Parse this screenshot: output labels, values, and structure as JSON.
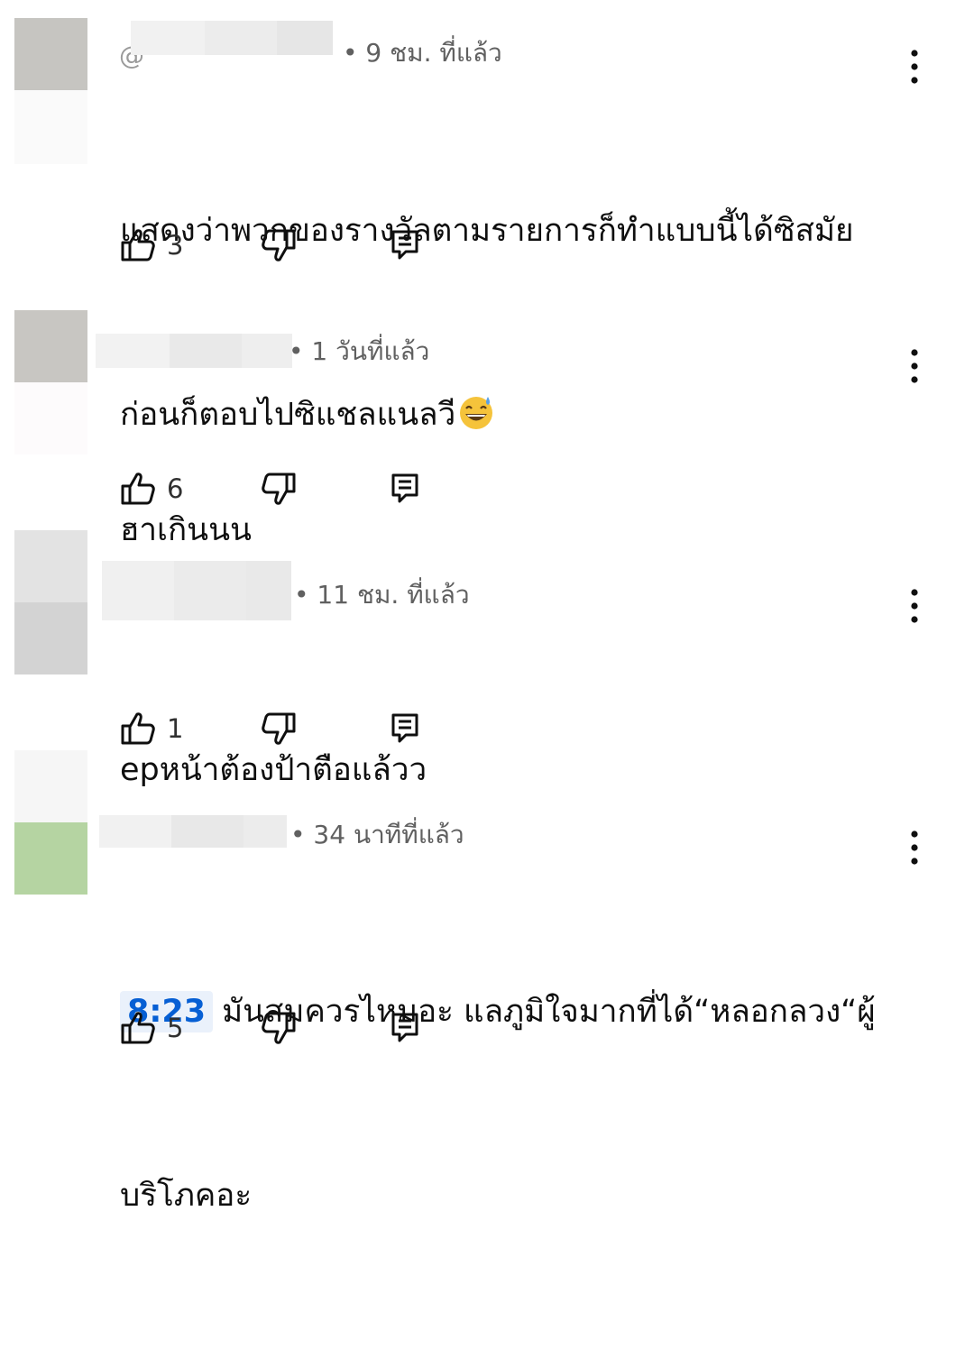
{
  "comments": [
    {
      "author_prefix": "@",
      "time": "• 9 ชม. ที่แล้ว",
      "text_line1": "แสดงว่าพวกของรางวัลตามรายการก็ทำแบบนี้ได้ซิสมัย",
      "text_line2": "ก่อนก็ตอบไปซิแชลแนลวี",
      "emoji": "grinning-face-with-sweat",
      "likes": "3"
    },
    {
      "author_prefix": "",
      "time": "• 1 วันที่แล้ว",
      "text_line1": "ฮาเกินนน",
      "likes": "6"
    },
    {
      "author_prefix": "",
      "time": "• 11 ชม. ที่แล้ว",
      "text_line1": "epหน้าต้องป้าตือแล้วว",
      "likes": "1"
    },
    {
      "author_prefix": "",
      "time": "• 34 นาทีที่แล้ว",
      "timestamp_link": "8:23",
      "text_line1": "มันสมควรไหมอะ แลภูมิใจมากที่ได้“หลอกลวง“ผู้",
      "text_line2": "บริโภคอะ",
      "likes": "5"
    }
  ],
  "icons": {
    "like": "thumb-up-icon",
    "dislike": "thumb-down-icon",
    "reply": "reply-comment-icon",
    "menu": "more-vertical-icon"
  },
  "colors": {
    "text": "#0f0f0f",
    "meta": "#606060",
    "link": "#065fd4",
    "avatar_green": "#b5d4a2"
  }
}
